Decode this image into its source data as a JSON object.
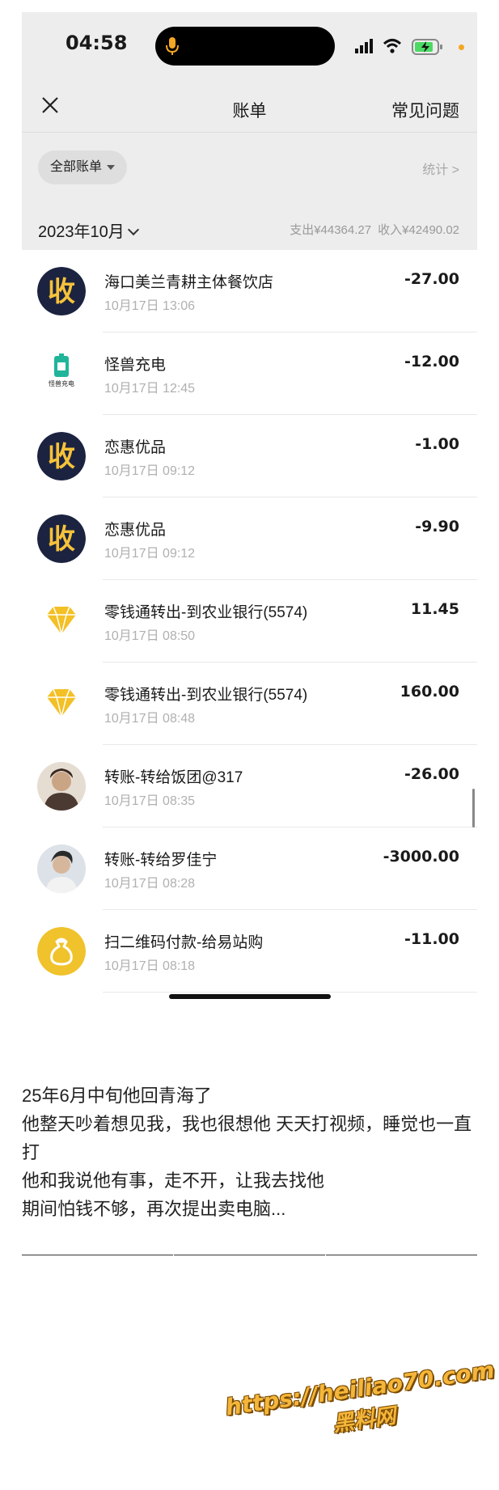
{
  "status_bar": {
    "time": "04:58"
  },
  "nav": {
    "title": "账单",
    "faq": "常见问题"
  },
  "filter": {
    "label": "全部账单",
    "stats": "统计 >"
  },
  "summary": {
    "month": "2023年10月",
    "expense": "支出¥44364.27",
    "income": "收入¥42490.02"
  },
  "transactions": [
    {
      "merchant": "海口美兰青耕主体餐饮店",
      "time": "10月17日 13:06",
      "amount": "-27.00",
      "icon": "shou-icon"
    },
    {
      "merchant": "怪兽充电",
      "time": "10月17日 12:45",
      "amount": "-12.00",
      "icon": "energy-monster-logo"
    },
    {
      "merchant": "恋惠优品",
      "time": "10月17日 09:12",
      "amount": "-1.00",
      "icon": "shou-icon"
    },
    {
      "merchant": "恋惠优品",
      "time": "10月17日 09:12",
      "amount": "-9.90",
      "icon": "shou-icon"
    },
    {
      "merchant": "零钱通转出-到农业银行(5574)",
      "time": "10月17日 08:50",
      "amount": "11.45",
      "icon": "diamond-icon"
    },
    {
      "merchant": "零钱通转出-到农业银行(5574)",
      "time": "10月17日 08:48",
      "amount": "160.00",
      "icon": "diamond-icon"
    },
    {
      "merchant": "转账-转给饭团@317",
      "time": "10月17日 08:35",
      "amount": "-26.00",
      "icon": "user-avatar"
    },
    {
      "merchant": "转账-转给罗佳宁",
      "time": "10月17日 08:28",
      "amount": "-3000.00",
      "icon": "user-avatar"
    },
    {
      "merchant": "扫二维码付款-给易站购",
      "time": "10月17日 08:18",
      "amount": "-11.00",
      "icon": "money-bag-icon"
    }
  ],
  "logo_text": {
    "energy_monster": "怪兽充电"
  },
  "post": {
    "lines": [
      "25年6月中旬他回青海了",
      "他整天吵着想见我，我也很想他 天天打视频，睡觉也一直打",
      "他和我说他有事，走不开，让我去找他",
      "期间怕钱不够，再次提出卖电脑..."
    ]
  },
  "watermark": {
    "url": "https://heiliao70.com",
    "name": "黑料网"
  },
  "colors": {
    "topbar_bg": "#ededed",
    "shou_bg": "#1c2340",
    "shou_fg": "#f5c23a",
    "gold": "#f3c025",
    "watermark": "#f4b63a"
  }
}
